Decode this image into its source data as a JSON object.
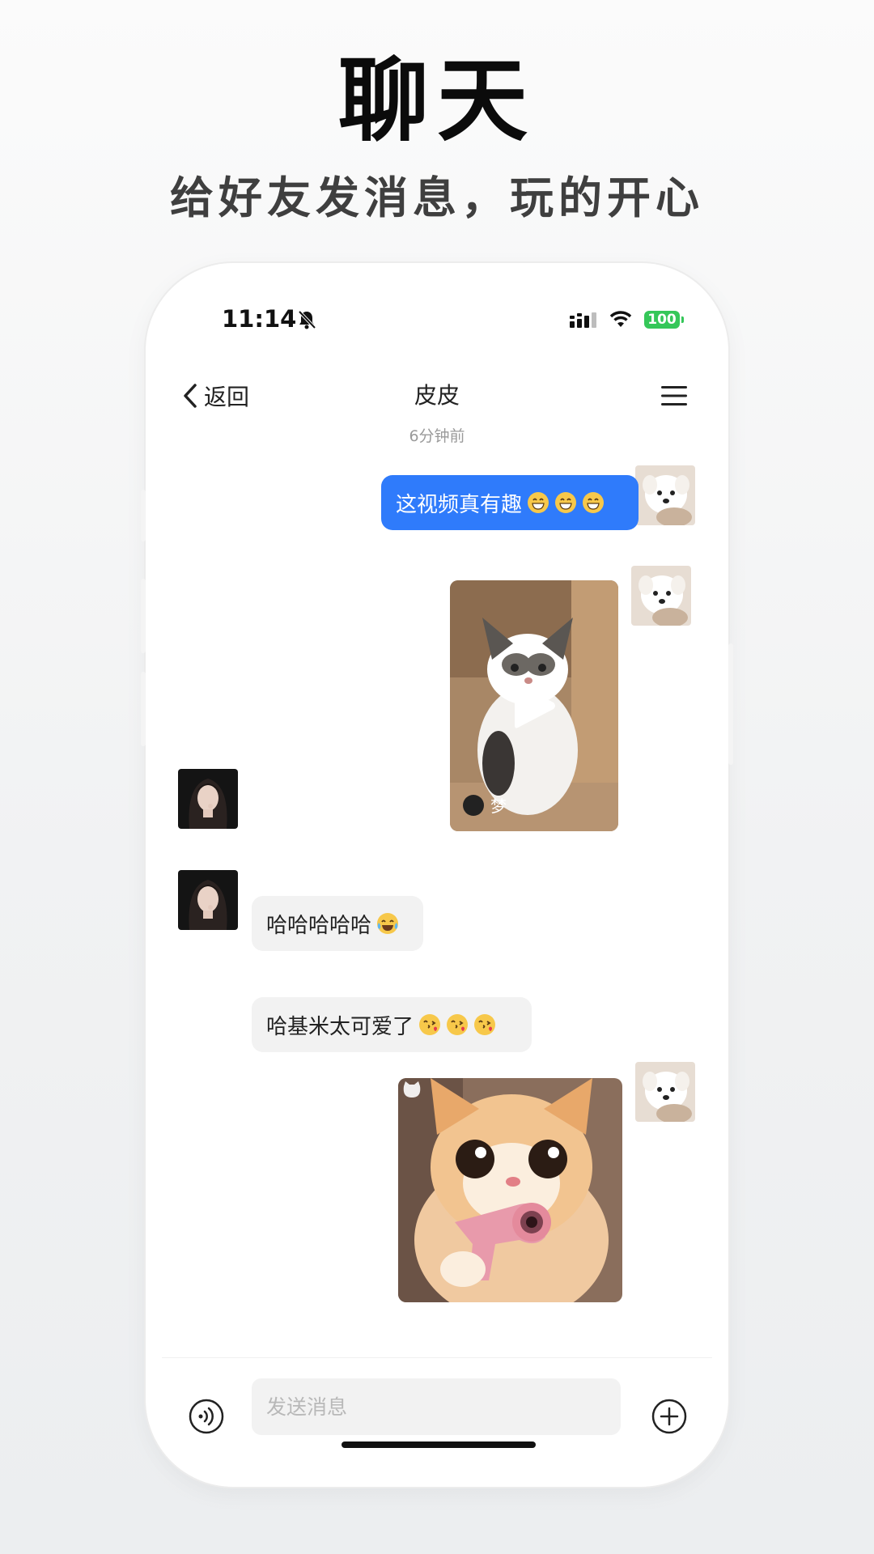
{
  "header": {
    "title": "聊天",
    "subtitle": "给好友发消息，玩的开心"
  },
  "status_bar": {
    "time": "11:14",
    "battery": "100"
  },
  "nav": {
    "back_label": "返回",
    "title": "皮皮"
  },
  "chat": {
    "timestamp": "6分钟前",
    "messages": [
      {
        "side": "out",
        "type": "text",
        "text": "这视频真有趣",
        "emoji": [
          "grinning-face-emoji",
          "grinning-face-emoji",
          "grinning-face-emoji"
        ]
      },
      {
        "side": "out",
        "type": "video",
        "caption": "梦"
      },
      {
        "side": "in",
        "type": "text",
        "text": "哈哈哈哈哈",
        "emoji": [
          "tears-of-joy-emoji"
        ]
      },
      {
        "side": "in",
        "type": "text",
        "text": "哈基米太可爱了",
        "emoji": [
          "kissing-face-emoji",
          "kissing-face-emoji",
          "kissing-face-emoji"
        ]
      },
      {
        "side": "out",
        "type": "image"
      }
    ]
  },
  "composer": {
    "placeholder": "发送消息"
  },
  "colors": {
    "outgoing_bubble": "#2f7bfb",
    "incoming_bubble": "#f2f2f2",
    "battery": "#35c759"
  }
}
